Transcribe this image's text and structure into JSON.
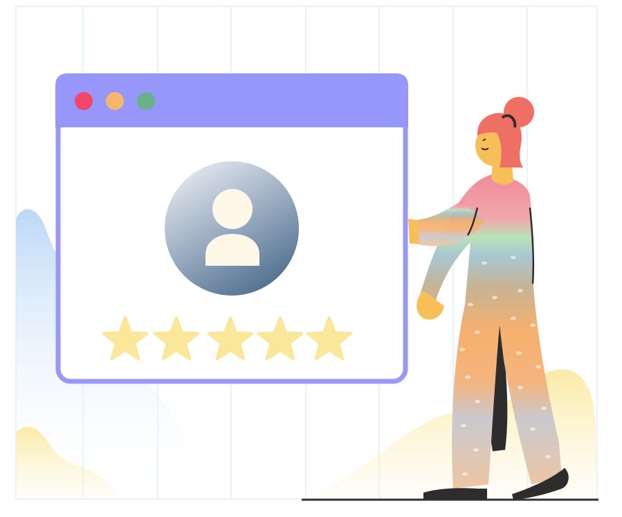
{
  "illustration": {
    "window": {
      "title_bar_color": "#9797fb",
      "frame_color": "#9a98f7",
      "controls": [
        {
          "name": "close",
          "color": "#f2466a"
        },
        {
          "name": "minimize",
          "color": "#f6b76c"
        },
        {
          "name": "maximize",
          "color": "#6ab18a"
        }
      ]
    },
    "avatar": {
      "icon": "user-icon",
      "gradient_colors": [
        "#e6eaf1",
        "#4a6a8c"
      ],
      "glyph_color": "#fdf7e8"
    },
    "rating": {
      "icon": "star-icon",
      "value": 5,
      "max": 5,
      "star_color": "#fbe79a"
    },
    "person": {
      "hair_color": "#ee6f63",
      "skin_color": "#f8be57",
      "shoe_color": "#2d2d2d"
    },
    "background": {
      "grid_color": "#e8f2fb",
      "hill_left_color": "#bcd8f6",
      "hill_yellow_color": "#fbeaa5",
      "ground_color": "#333333"
    }
  }
}
